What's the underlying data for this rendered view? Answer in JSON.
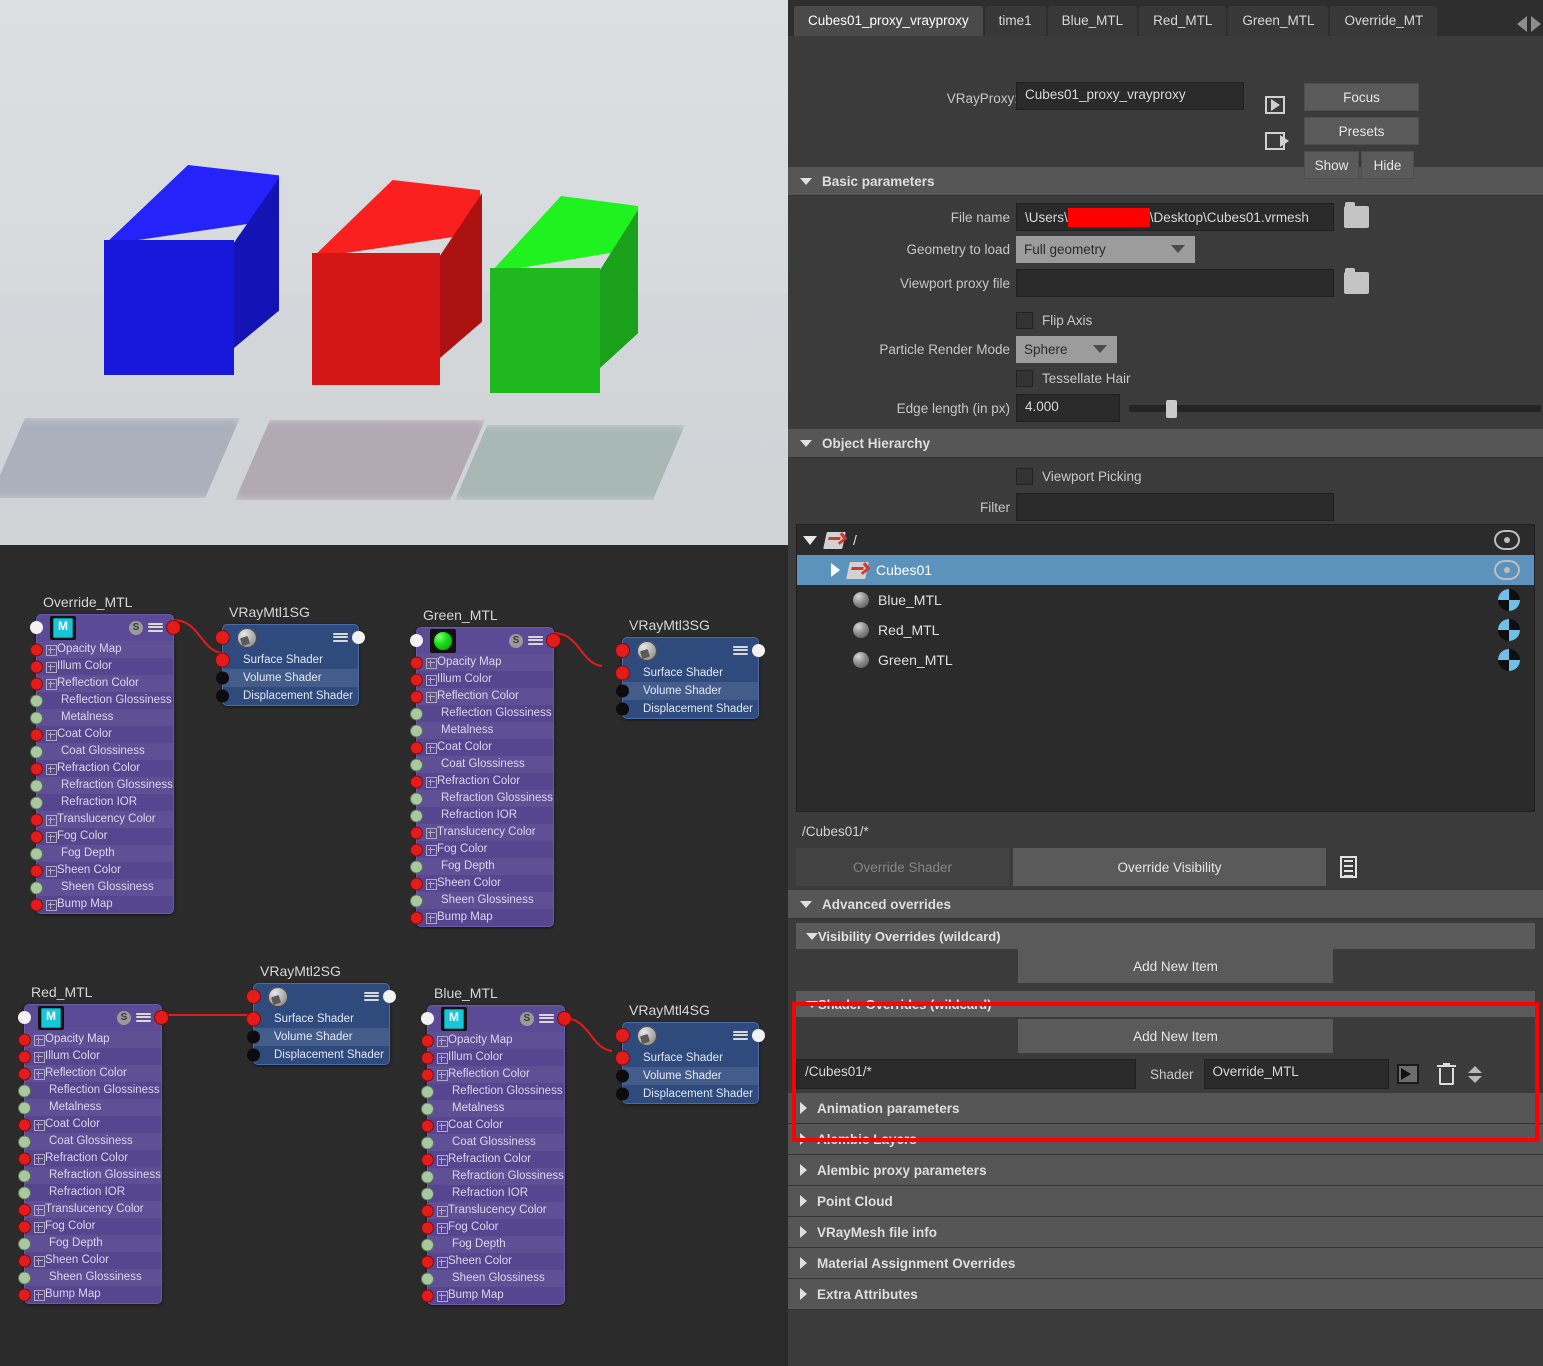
{
  "viewport": {
    "name": "render-view",
    "cubes": [
      {
        "label": "blue-cube",
        "color": "#1a1ae6",
        "top": "#2626ff",
        "side": "#1414b4"
      },
      {
        "label": "red-cube",
        "color": "#e81414",
        "top": "#ff1a1a",
        "side": "#b01010"
      },
      {
        "label": "green-cube",
        "color": "#1cc21c",
        "top": "#22e822",
        "side": "#17a317"
      }
    ],
    "background": "#d7dbde"
  },
  "node_editor": {
    "material_attributes": [
      {
        "label": "Opacity Map",
        "plug": "red",
        "expandable": true
      },
      {
        "label": "Illum Color",
        "plug": "red",
        "expandable": true
      },
      {
        "label": "Reflection Color",
        "plug": "red",
        "expandable": true
      },
      {
        "label": "Reflection Glossiness",
        "plug": "green",
        "expandable": false
      },
      {
        "label": "Metalness",
        "plug": "green",
        "expandable": false
      },
      {
        "label": "Coat Color",
        "plug": "red",
        "expandable": true
      },
      {
        "label": "Coat Glossiness",
        "plug": "green",
        "expandable": false
      },
      {
        "label": "Refraction Color",
        "plug": "red",
        "expandable": true
      },
      {
        "label": "Refraction Glossiness",
        "plug": "green",
        "expandable": false
      },
      {
        "label": "Refraction IOR",
        "plug": "green",
        "expandable": false
      },
      {
        "label": "Translucency Color",
        "plug": "red",
        "expandable": true
      },
      {
        "label": "Fog Color",
        "plug": "red",
        "expandable": true
      },
      {
        "label": "Fog Depth",
        "plug": "green",
        "expandable": false
      },
      {
        "label": "Sheen Color",
        "plug": "red",
        "expandable": true
      },
      {
        "label": "Sheen Glossiness",
        "plug": "green",
        "expandable": false
      },
      {
        "label": "Bump Map",
        "plug": "red",
        "expandable": true
      }
    ],
    "sg_attributes": [
      {
        "label": "Surface Shader",
        "plug": "red"
      },
      {
        "label": "Volume Shader",
        "plug": "black"
      },
      {
        "label": "Displacement Shader",
        "plug": "black"
      }
    ],
    "nodes": {
      "override_mtl": {
        "title": "Override_MTL",
        "swatch": "material-icon"
      },
      "vraymtl1sg": {
        "title": "VRayMtl1SG"
      },
      "green_mtl": {
        "title": "Green_MTL",
        "swatch": "green-sphere"
      },
      "vraymtl3sg": {
        "title": "VRayMtl3SG"
      },
      "red_mtl": {
        "title": "Red_MTL",
        "swatch": "material-icon"
      },
      "vraymtl2sg": {
        "title": "VRayMtl2SG"
      },
      "blue_mtl": {
        "title": "Blue_MTL",
        "swatch": "material-icon"
      },
      "vraymtl4sg": {
        "title": "VRayMtl4SG"
      }
    },
    "badge_letter": "S"
  },
  "panel": {
    "tabs": [
      {
        "label": "Cubes01_proxy_vrayproxy",
        "active": true
      },
      {
        "label": "time1",
        "active": false
      },
      {
        "label": "Blue_MTL",
        "active": false
      },
      {
        "label": "Red_MTL",
        "active": false
      },
      {
        "label": "Green_MTL",
        "active": false
      },
      {
        "label": "Override_MT",
        "active": false
      }
    ],
    "header": {
      "proxy_label": "VRayProxy:",
      "proxy_value": "Cubes01_proxy_vrayproxy",
      "focus_label": "Focus",
      "presets_label": "Presets",
      "show_label": "Show",
      "hide_label": "Hide"
    },
    "basic_parameters": {
      "title": "Basic parameters",
      "file_name_label": "File name",
      "file_name_prefix": "\\Users\\",
      "file_name_suffix": "\\Desktop\\Cubes01.vrmesh",
      "redaction_color": "#ff0000",
      "geometry_label": "Geometry to load",
      "geometry_value": "Full geometry",
      "viewport_proxy_label": "Viewport proxy file",
      "viewport_proxy_value": "",
      "flip_axis_label": "Flip Axis",
      "flip_axis_checked": false,
      "particle_render_label": "Particle Render Mode",
      "particle_render_value": "Sphere",
      "tessellate_hair_label": "Tessellate Hair",
      "tessellate_hair_checked": false,
      "edge_length_label": "Edge length (in px)",
      "edge_length_value": "4.000",
      "edge_length_slider_pct": 9
    },
    "object_hierarchy": {
      "title": "Object Hierarchy",
      "viewport_picking_label": "Viewport Picking",
      "viewport_picking_checked": false,
      "filter_label": "Filter",
      "filter_value": "",
      "tree": [
        {
          "label": "/",
          "icon": "transform-icon",
          "indent": 0,
          "expanded": true,
          "selected": false,
          "right_icon": "eye-icon"
        },
        {
          "label": "Cubes01",
          "icon": "transform-icon",
          "indent": 1,
          "expanded": false,
          "selected": true,
          "right_icon": "eye-icon"
        },
        {
          "label": "Blue_MTL",
          "icon": "shader-ball-icon",
          "indent": 1,
          "selected": false,
          "right_icon": "pie-icon"
        },
        {
          "label": "Red_MTL",
          "icon": "shader-ball-icon",
          "indent": 1,
          "selected": false,
          "right_icon": "pie-icon"
        },
        {
          "label": "Green_MTL",
          "icon": "shader-ball-icon",
          "indent": 1,
          "selected": false,
          "right_icon": "pie-icon"
        }
      ],
      "selected_path": "/Cubes01/*",
      "override_shader_label": "Override Shader",
      "override_shader_enabled": false,
      "override_visibility_label": "Override Visibility"
    },
    "advanced_overrides": {
      "title": "Advanced overrides",
      "visibility_overrides_title": "Visibility Overrides (wildcard)",
      "visibility_add_label": "Add New Item",
      "shader_overrides_title": "Shader Overrides (wildcard)",
      "shader_add_label": "Add New Item",
      "shader_row": {
        "path_value": "/Cubes01/*",
        "shader_label": "Shader",
        "shader_value": "Override_MTL"
      },
      "highlight_color": "#ff0000"
    },
    "collapsed_sections": [
      "Animation parameters",
      "Alembic Layers",
      "Alembic proxy parameters",
      "Point Cloud",
      "VRayMesh file info",
      "Material Assignment Overrides",
      "Extra Attributes"
    ]
  }
}
